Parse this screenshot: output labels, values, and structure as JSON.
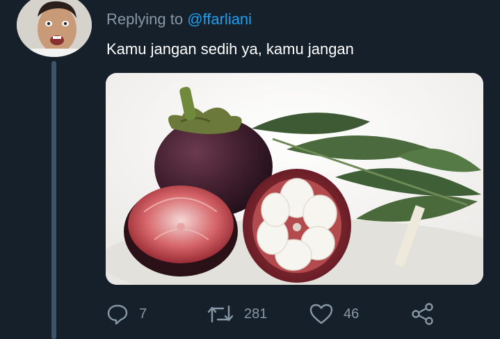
{
  "reply": {
    "prefix": "Replying to",
    "handle": "@ffarliani"
  },
  "tweet": {
    "text": "Kamu jangan sedih ya, kamu jangan"
  },
  "media": {
    "subject": "mangosteen fruit photo"
  },
  "actions": {
    "reply_count": "7",
    "retweet_count": "281",
    "like_count": "46"
  },
  "icons": {
    "reply": "reply-icon",
    "retweet": "retweet-icon",
    "like": "heart-icon",
    "share": "share-icon"
  },
  "colors": {
    "background": "#15202b",
    "muted_text": "#8899a6",
    "link": "#1da1f2",
    "thread_line": "#3d5466"
  }
}
